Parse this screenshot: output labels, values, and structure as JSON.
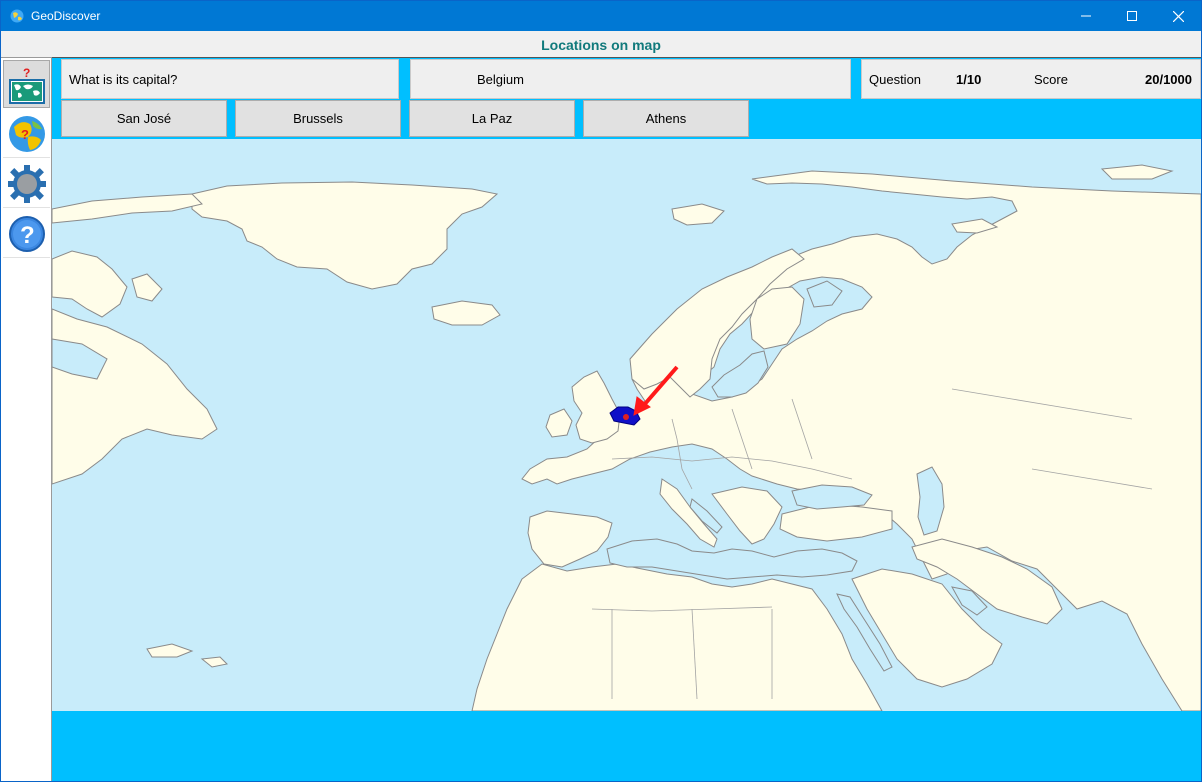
{
  "window": {
    "title": "GeoDiscover"
  },
  "header": {
    "title": "Locations on map"
  },
  "sidebar": {
    "items": [
      {
        "name": "map-quiz",
        "icon": "map-question-icon",
        "active": true
      },
      {
        "name": "globe-quiz",
        "icon": "globe-question-icon",
        "active": false
      },
      {
        "name": "settings",
        "icon": "gear-icon",
        "active": false
      },
      {
        "name": "help",
        "icon": "help-icon",
        "active": false
      }
    ]
  },
  "quiz": {
    "question": "What is its capital?",
    "country": "Belgium",
    "question_label": "Question",
    "question_progress": "1/10",
    "score_label": "Score",
    "score_value": "20/1000",
    "answers": [
      "San José",
      "Brussels",
      "La Paz",
      "Athens"
    ]
  },
  "colors": {
    "titlebar": "#0078d4",
    "accent": "#00bfff",
    "header_text": "#117a7c",
    "sea": "#c8ecfa",
    "land": "#fffde9",
    "highlight_country": "#1010c8",
    "arrow": "#ff1a1a"
  }
}
